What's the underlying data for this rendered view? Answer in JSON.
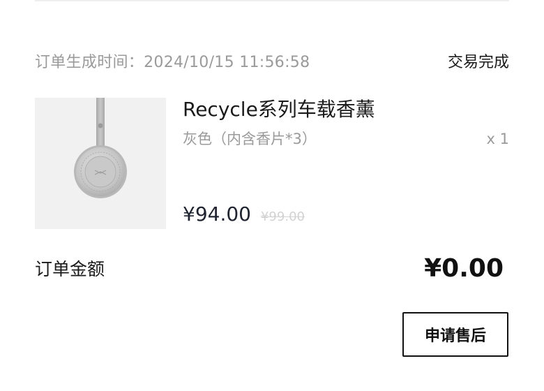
{
  "order": {
    "time_label": "订单生成时间：2024/10/15 11:56:58",
    "status": "交易完成"
  },
  "product": {
    "image_icon": "car-air-freshener-product-image",
    "name": "Recycle系列车载香薰",
    "variant": "灰色（内含香片*3）",
    "quantity": "x 1",
    "price": "¥94.00",
    "original_price": "¥99.00"
  },
  "total": {
    "label": "订单金额",
    "amount": "¥0.00"
  },
  "actions": {
    "after_sale_label": "申请售后"
  },
  "colors": {
    "muted_text": "#9a9a9a",
    "strikethrough_price": "#d2d2d2",
    "primary_text": "#1a1a1a",
    "thumbnail_bg": "#f1f1f1"
  }
}
